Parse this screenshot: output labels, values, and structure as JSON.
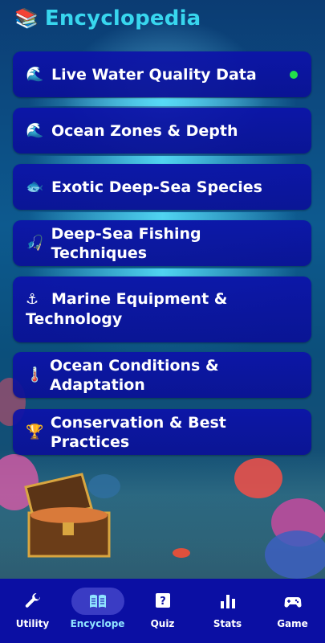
{
  "header": {
    "title": "Encyclopedia",
    "icon": "books-icon"
  },
  "cards": [
    {
      "emoji": "🌊",
      "label": "Live Water Quality Data",
      "status_color": "#22e04a"
    },
    {
      "emoji": "🌊",
      "label": "Ocean Zones & Depth"
    },
    {
      "emoji": "🐟",
      "label": "Exotic Deep-Sea Species"
    },
    {
      "emoji": "🎣",
      "label": "Deep-Sea Fishing Techniques"
    },
    {
      "emoji": "⚓",
      "label_line1": "Marine Equipment &",
      "label_line2": "Technology"
    },
    {
      "emoji": "🌡️",
      "label": "Ocean Conditions & Adaptation"
    },
    {
      "emoji": "🏆",
      "label": "Conservation & Best Practices"
    }
  ],
  "bottom_nav": [
    {
      "label": "Utility",
      "icon": "wrench-icon"
    },
    {
      "label": "Encyclope",
      "icon": "book-icon",
      "active": true
    },
    {
      "label": "Quiz",
      "icon": "quiz-icon"
    },
    {
      "label": "Stats",
      "icon": "bar-chart-icon"
    },
    {
      "label": "Game",
      "icon": "gamepad-icon"
    }
  ],
  "colors": {
    "accent": "#38d6ee",
    "card": "#0c12aa",
    "nav": "#0b0fa3",
    "active_label": "#8fe3ff"
  }
}
